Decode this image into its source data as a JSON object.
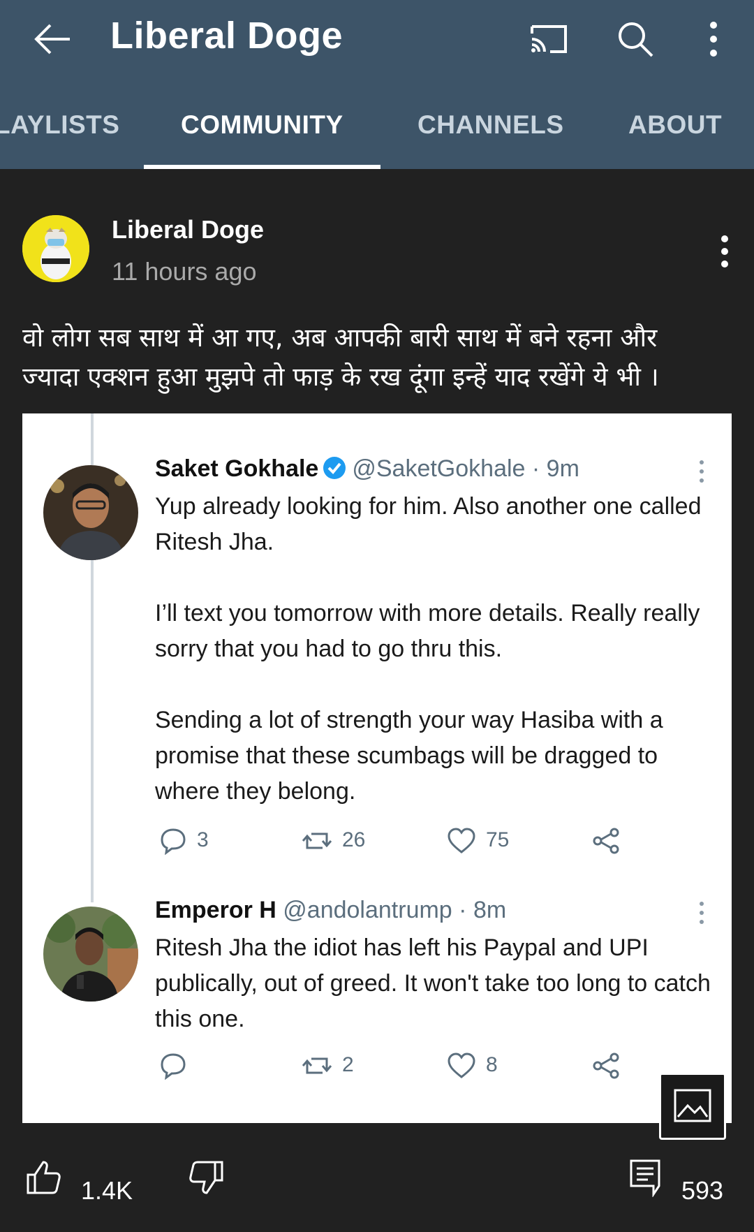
{
  "app": {
    "title": "Liberal Doge",
    "icons": [
      "back-arrow-icon",
      "cast-icon",
      "search-icon",
      "more-vert-icon"
    ]
  },
  "tabs": [
    {
      "label": "LAYLISTS",
      "active": false
    },
    {
      "label": "COMMUNITY",
      "active": true
    },
    {
      "label": "CHANNELS",
      "active": false
    },
    {
      "label": "ABOUT",
      "active": false
    }
  ],
  "post": {
    "author": "Liberal Doge",
    "time": "11 hours ago",
    "text_line1": "वो लोग सब साथ में आ गए, अब आपकी बारी साथ में बने रहना और",
    "text_line2": "ज्यादा एक्शन हुआ मुझपे तो फाड़ के रख दूंगा इन्हें याद रखेंगे ये भी ।",
    "likes": "1.4K",
    "comments": "593"
  },
  "embedded_tweets": [
    {
      "name": "Saket Gokhale",
      "verified": true,
      "handle": "@SaketGokhale",
      "time": "· 9m",
      "paragraph1": "Yup already looking for him. Also another one called Ritesh Jha.",
      "paragraph2": "I’ll text you tomorrow with more details. Really really sorry that you had to go thru this.",
      "paragraph3": "Sending a lot of strength your way Hasiba with a promise that these scumbags will be dragged to where they belong.",
      "replies": "3",
      "retweets": "26",
      "likes": "75"
    },
    {
      "name": "Emperor H",
      "verified": false,
      "handle": "@andolantrump",
      "time": "· 8m",
      "paragraph1": "Ritesh Jha the idiot has left his Paypal and UPI publically, out of greed. It won't take too long to catch this one.",
      "replies": "",
      "retweets": "2",
      "likes": "8"
    }
  ],
  "colors": {
    "appbar": "#3d5468",
    "background": "#212121",
    "verified": "#1d9bf0",
    "avatar_bg": "#f1e21a"
  }
}
